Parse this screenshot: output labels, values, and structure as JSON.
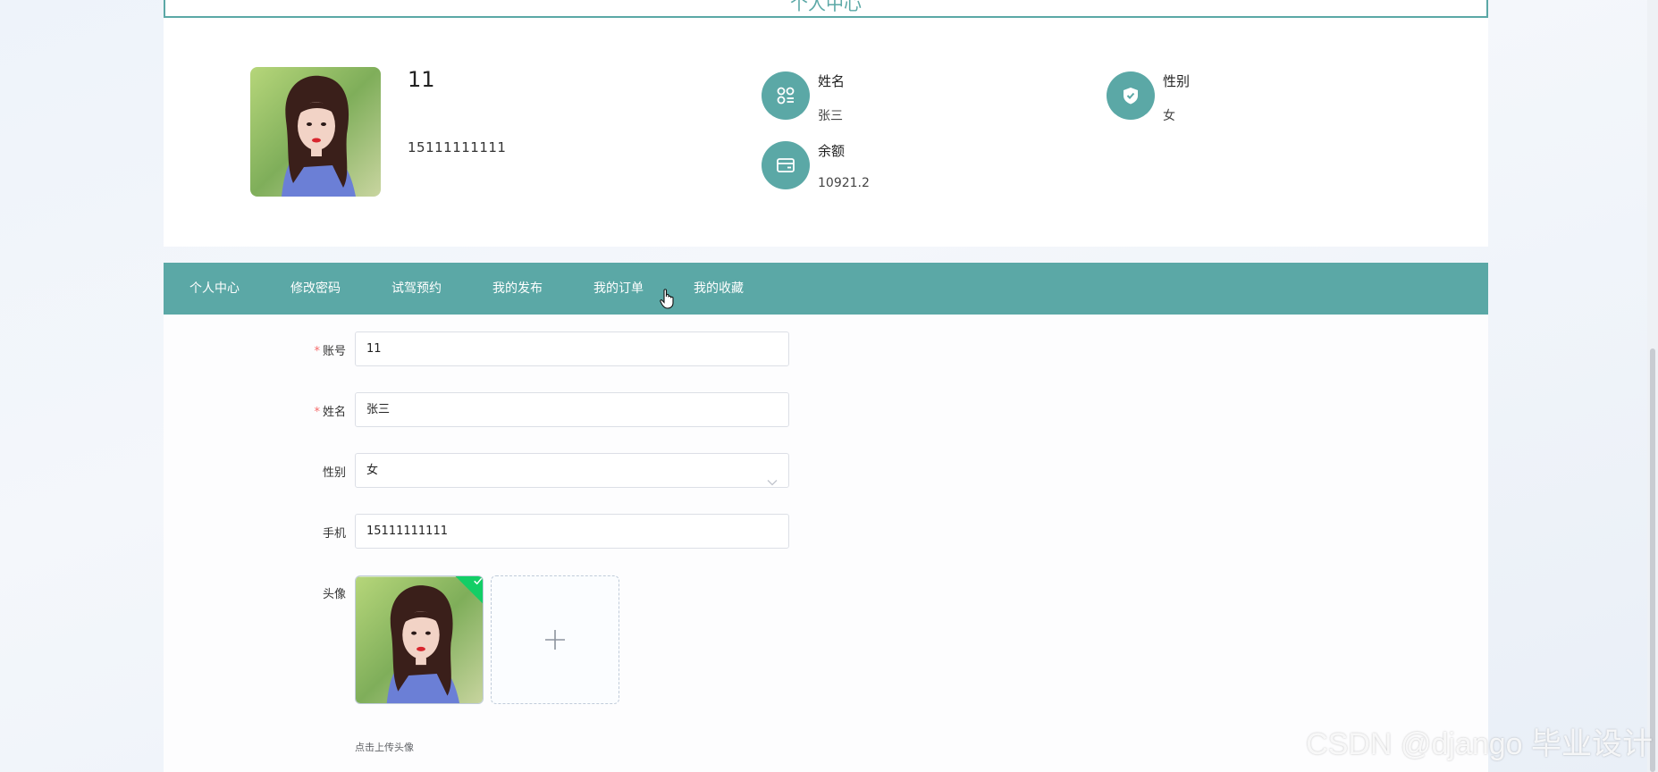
{
  "page": {
    "title": "个人中心"
  },
  "profile": {
    "username": "11",
    "phone": "15111111111",
    "avatar": "girl-portrait-photo",
    "info": [
      {
        "label": "姓名",
        "value": "张三",
        "icon": "apps-icon"
      },
      {
        "label": "性别",
        "value": "女",
        "icon": "shield-check-icon"
      },
      {
        "label": "余额",
        "value": "10921.2",
        "icon": "wallet-icon"
      }
    ]
  },
  "tabs": [
    {
      "label": "个人中心"
    },
    {
      "label": "修改密码"
    },
    {
      "label": "试驾预约"
    },
    {
      "label": "我的发布"
    },
    {
      "label": "我的订单"
    },
    {
      "label": "我的收藏"
    }
  ],
  "form": {
    "account": {
      "label": "账号",
      "required": true,
      "value": "11"
    },
    "name": {
      "label": "姓名",
      "required": true,
      "value": "张三"
    },
    "gender": {
      "label": "性别",
      "value": "女"
    },
    "phone": {
      "label": "手机",
      "value": "15111111111"
    },
    "avatar": {
      "label": "头像",
      "tip": "点击上传头像"
    }
  },
  "colors": {
    "accent": "#5ba8a6",
    "success": "#13ce66",
    "required": "#f56c6c"
  },
  "watermark": "CSDN @django  毕业设计"
}
